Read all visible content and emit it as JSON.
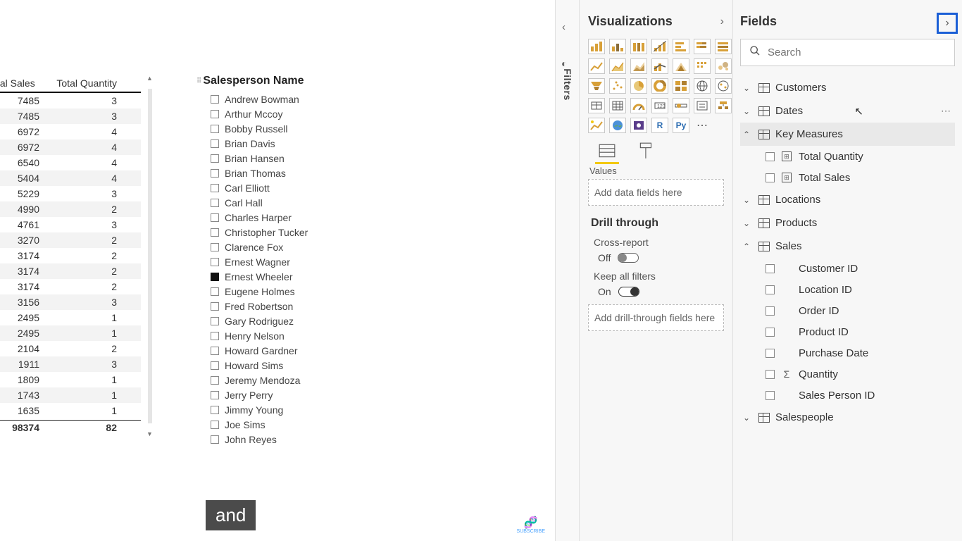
{
  "table": {
    "col_sales": "tal Sales",
    "col_qty": "Total Quantity",
    "rows": [
      {
        "s": "7485",
        "q": "3"
      },
      {
        "s": "7485",
        "q": "3"
      },
      {
        "s": "6972",
        "q": "4"
      },
      {
        "s": "6972",
        "q": "4"
      },
      {
        "s": "6540",
        "q": "4"
      },
      {
        "s": "5404",
        "q": "4"
      },
      {
        "s": "5229",
        "q": "3"
      },
      {
        "s": "4990",
        "q": "2"
      },
      {
        "s": "4761",
        "q": "3"
      },
      {
        "s": "3270",
        "q": "2"
      },
      {
        "s": "3174",
        "q": "2"
      },
      {
        "s": "3174",
        "q": "2"
      },
      {
        "s": "3174",
        "q": "2"
      },
      {
        "s": "3156",
        "q": "3"
      },
      {
        "s": "2495",
        "q": "1"
      },
      {
        "s": "2495",
        "q": "1"
      },
      {
        "s": "2104",
        "q": "2"
      },
      {
        "s": "1911",
        "q": "3"
      },
      {
        "s": "1809",
        "q": "1"
      },
      {
        "s": "1743",
        "q": "1"
      },
      {
        "s": "1635",
        "q": "1"
      }
    ],
    "totals": {
      "s": "98374",
      "q": "82"
    }
  },
  "slicer": {
    "title": "Salesperson Name",
    "items": [
      {
        "label": "Andrew Bowman",
        "checked": false
      },
      {
        "label": "Arthur Mccoy",
        "checked": false
      },
      {
        "label": "Bobby Russell",
        "checked": false
      },
      {
        "label": "Brian Davis",
        "checked": false
      },
      {
        "label": "Brian Hansen",
        "checked": false
      },
      {
        "label": "Brian Thomas",
        "checked": false
      },
      {
        "label": "Carl Elliott",
        "checked": false
      },
      {
        "label": "Carl Hall",
        "checked": false
      },
      {
        "label": "Charles Harper",
        "checked": false
      },
      {
        "label": "Christopher Tucker",
        "checked": false
      },
      {
        "label": "Clarence Fox",
        "checked": false
      },
      {
        "label": "Ernest Wagner",
        "checked": false
      },
      {
        "label": "Ernest Wheeler",
        "checked": true
      },
      {
        "label": "Eugene Holmes",
        "checked": false
      },
      {
        "label": "Fred Robertson",
        "checked": false
      },
      {
        "label": "Gary Rodriguez",
        "checked": false
      },
      {
        "label": "Henry Nelson",
        "checked": false
      },
      {
        "label": "Howard Gardner",
        "checked": false
      },
      {
        "label": "Howard Sims",
        "checked": false
      },
      {
        "label": "Jeremy Mendoza",
        "checked": false
      },
      {
        "label": "Jerry Perry",
        "checked": false
      },
      {
        "label": "Jimmy Young",
        "checked": false
      },
      {
        "label": "Joe Sims",
        "checked": false
      },
      {
        "label": "John Reyes",
        "checked": false
      }
    ]
  },
  "caption": "and",
  "filters_pane": {
    "label": "Filters"
  },
  "viz_pane": {
    "title": "Visualizations",
    "values_label": "Values",
    "values_placeholder": "Add data fields here",
    "drill_label": "Drill through",
    "cross_report_label": "Cross-report",
    "cross_report_state": "Off",
    "keep_filters_label": "Keep all filters",
    "keep_filters_state": "On",
    "drill_placeholder": "Add drill-through fields here"
  },
  "fields_pane": {
    "title": "Fields",
    "search_placeholder": "Search",
    "tables": {
      "customers": "Customers",
      "dates": "Dates",
      "key_measures": "Key Measures",
      "locations": "Locations",
      "products": "Products",
      "sales": "Sales",
      "salespeople": "Salespeople"
    },
    "key_measures_fields": [
      "Total Quantity",
      "Total Sales"
    ],
    "sales_fields": [
      {
        "label": "Customer ID",
        "type": "plain"
      },
      {
        "label": "Location ID",
        "type": "plain"
      },
      {
        "label": "Order ID",
        "type": "plain"
      },
      {
        "label": "Product ID",
        "type": "plain"
      },
      {
        "label": "Purchase Date",
        "type": "plain"
      },
      {
        "label": "Quantity",
        "type": "sigma"
      },
      {
        "label": "Sales Person ID",
        "type": "plain"
      }
    ]
  },
  "subscribe": "SUBSCRIBE"
}
